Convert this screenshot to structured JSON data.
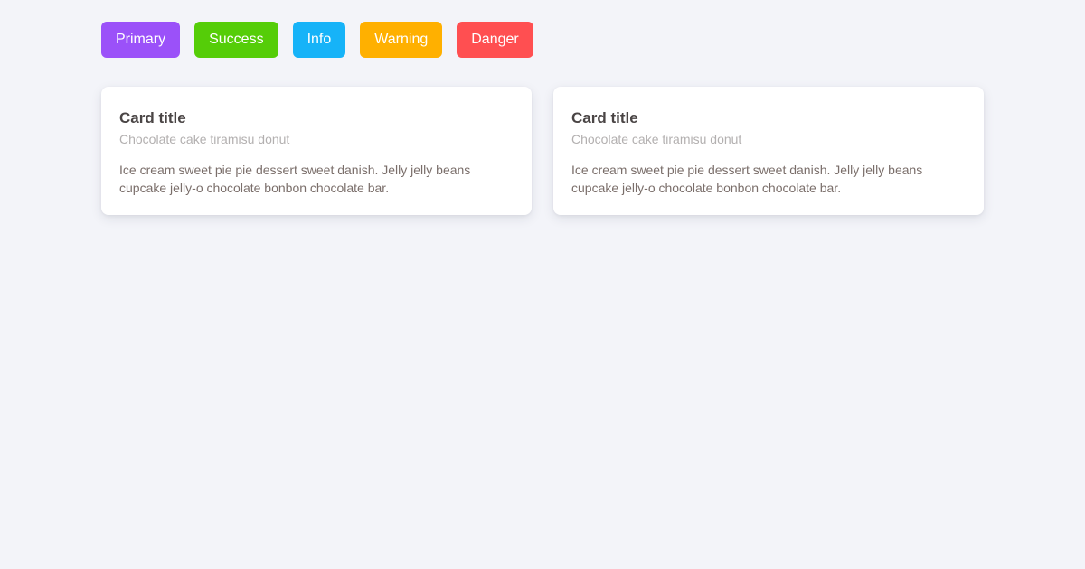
{
  "buttons": [
    {
      "label": "Primary",
      "color": "#9b51f9"
    },
    {
      "label": "Success",
      "color": "#55cd08"
    },
    {
      "label": "Info",
      "color": "#16b3f8"
    },
    {
      "label": "Warning",
      "color": "#ffb000"
    },
    {
      "label": "Danger",
      "color": "#ff4f51"
    }
  ],
  "cards": [
    {
      "title": "Card title",
      "subtitle": "Chocolate cake tiramisu donut",
      "text": "Ice cream sweet pie pie dessert sweet danish. Jelly jelly beans cupcake jelly-o chocolate bonbon chocolate bar."
    },
    {
      "title": "Card title",
      "subtitle": "Chocolate cake tiramisu donut",
      "text": "Ice cream sweet pie pie dessert sweet danish. Jelly jelly beans cupcake jelly-o chocolate bonbon chocolate bar."
    }
  ],
  "colors": {
    "page_background": "#f3f4f9",
    "card_background": "#ffffff",
    "title": "#4a4545",
    "subtitle": "#b3b0b0",
    "body_text": "#7a6e6a"
  }
}
